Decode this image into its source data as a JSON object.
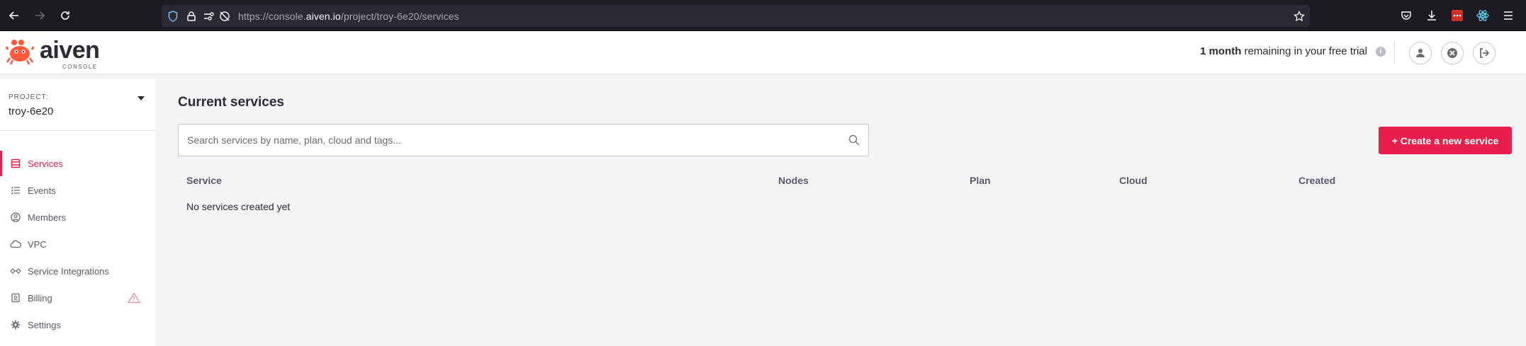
{
  "browser": {
    "url_prefix": "https://console.",
    "url_domain": "aiven.io",
    "url_path": "/project/troy-6e20/services"
  },
  "header": {
    "logo_word": "aiven",
    "logo_sub": "CONSOLE",
    "trial_bold": "1 month",
    "trial_rest": "remaining in your free trial",
    "info_glyph": "i"
  },
  "sidebar": {
    "project_label": "PROJECT:",
    "project_name": "troy-6e20",
    "items": [
      {
        "label": "Services",
        "icon": "services-icon",
        "active": true
      },
      {
        "label": "Events",
        "icon": "events-icon"
      },
      {
        "label": "Members",
        "icon": "members-icon"
      },
      {
        "label": "VPC",
        "icon": "cloud-icon"
      },
      {
        "label": "Service Integrations",
        "icon": "integrations-icon"
      },
      {
        "label": "Billing",
        "icon": "billing-icon",
        "warning": true
      },
      {
        "label": "Settings",
        "icon": "gear-icon"
      }
    ]
  },
  "main": {
    "title": "Current services",
    "search_placeholder": "Search services by name, plan, cloud and tags...",
    "create_button": "+ Create a new service",
    "columns": [
      "Service",
      "Nodes",
      "Plan",
      "Cloud",
      "Created"
    ],
    "empty_message": "No services created yet"
  },
  "colors": {
    "accent": "#e81e4d",
    "browser_bg": "#1c1b22",
    "url_bg": "#2b2a33"
  }
}
